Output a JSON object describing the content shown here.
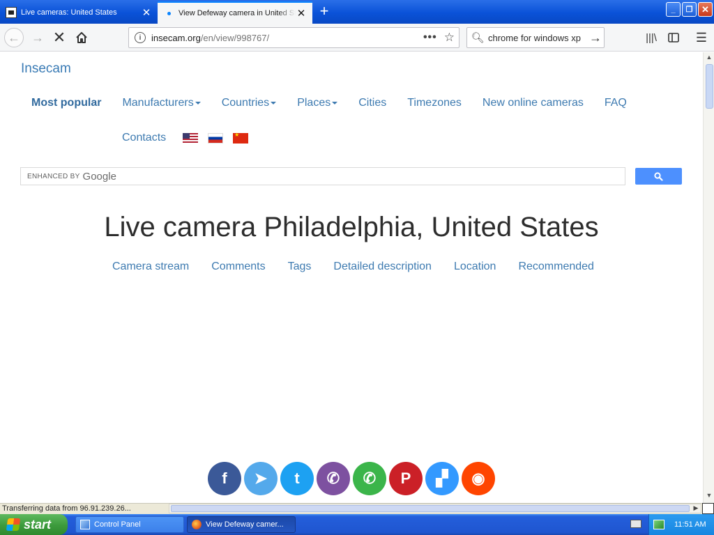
{
  "browser": {
    "tabs": [
      {
        "title": "Live cameras: United States",
        "active": false
      },
      {
        "title": "View Defeway camera in United St",
        "active": true
      }
    ],
    "new_tab_icon": "plus-icon",
    "url_host": "insecam.org",
    "url_path": "/en/view/998767/",
    "url_menu_icon": "ellipsis-icon",
    "bookmark_icon": "star-icon",
    "search_query": "chrome for windows xp",
    "window_buttons": {
      "minimize": "_",
      "restore": "❐",
      "close": "✕"
    }
  },
  "page": {
    "brand": "Insecam",
    "nav": [
      {
        "label": "Most popular",
        "active": true,
        "dropdown": false
      },
      {
        "label": "Manufacturers",
        "active": false,
        "dropdown": true
      },
      {
        "label": "Countries",
        "active": false,
        "dropdown": true
      },
      {
        "label": "Places",
        "active": false,
        "dropdown": true
      },
      {
        "label": "Cities",
        "active": false,
        "dropdown": false
      },
      {
        "label": "Timezones",
        "active": false,
        "dropdown": false
      },
      {
        "label": "New online cameras",
        "active": false,
        "dropdown": false
      },
      {
        "label": "FAQ",
        "active": false,
        "dropdown": false
      },
      {
        "label": "Contacts",
        "active": false,
        "dropdown": false
      }
    ],
    "language_flags": [
      "flag-us",
      "flag-ru",
      "flag-cn"
    ],
    "search": {
      "placeholder": "ENHANCED BY Google",
      "enhanced_label": "ENHANCED BY",
      "google_label": "Google",
      "button_icon": "search-icon"
    },
    "headline": "Live camera Philadelphia, United States",
    "subnav": [
      "Camera stream",
      "Comments",
      "Tags",
      "Detailed description",
      "Location",
      "Recommended"
    ],
    "social": [
      {
        "name": "facebook",
        "glyph": "f",
        "color": "#3b5998"
      },
      {
        "name": "telegram",
        "glyph": "➤",
        "color": "#54a9eb"
      },
      {
        "name": "twitter",
        "glyph": "t",
        "color": "#1da1f2"
      },
      {
        "name": "viber",
        "glyph": "✆",
        "color": "#7d51a0"
      },
      {
        "name": "whatsapp",
        "glyph": "✆",
        "color": "#3bb54a"
      },
      {
        "name": "pinterest",
        "glyph": "P",
        "color": "#cb2027"
      },
      {
        "name": "delicious",
        "glyph": "▞",
        "color": "#3399ff"
      },
      {
        "name": "reddit",
        "glyph": "◉",
        "color": "#ff4500"
      }
    ]
  },
  "status": {
    "text": "Transferring data from 96.91.239.26..."
  },
  "taskbar": {
    "start_label": "start",
    "items": [
      {
        "label": "Control Panel",
        "active": false
      },
      {
        "label": "View Defeway camer...",
        "active": true
      }
    ],
    "clock": "11:51 AM"
  }
}
